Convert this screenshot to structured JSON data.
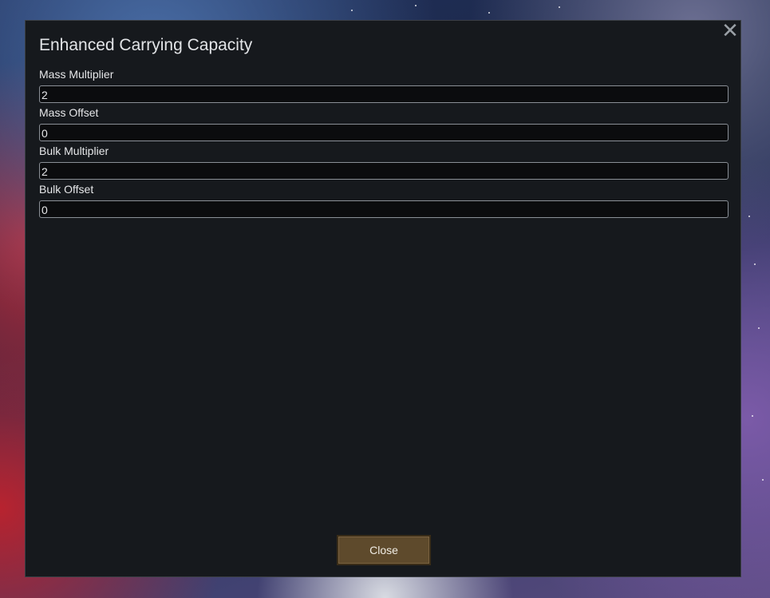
{
  "dialog": {
    "title": "Enhanced Carrying Capacity",
    "close_icon": "close-icon",
    "close_glyph": "✕",
    "fields": [
      {
        "label": "Mass Multiplier",
        "value": "2"
      },
      {
        "label": "Mass Offset",
        "value": "0"
      },
      {
        "label": "Bulk Multiplier",
        "value": "2"
      },
      {
        "label": "Bulk Offset",
        "value": "0"
      }
    ],
    "close_button_label": "Close"
  },
  "colors": {
    "dialog_background": "#16191d",
    "button_background": "#5e4a2c"
  }
}
